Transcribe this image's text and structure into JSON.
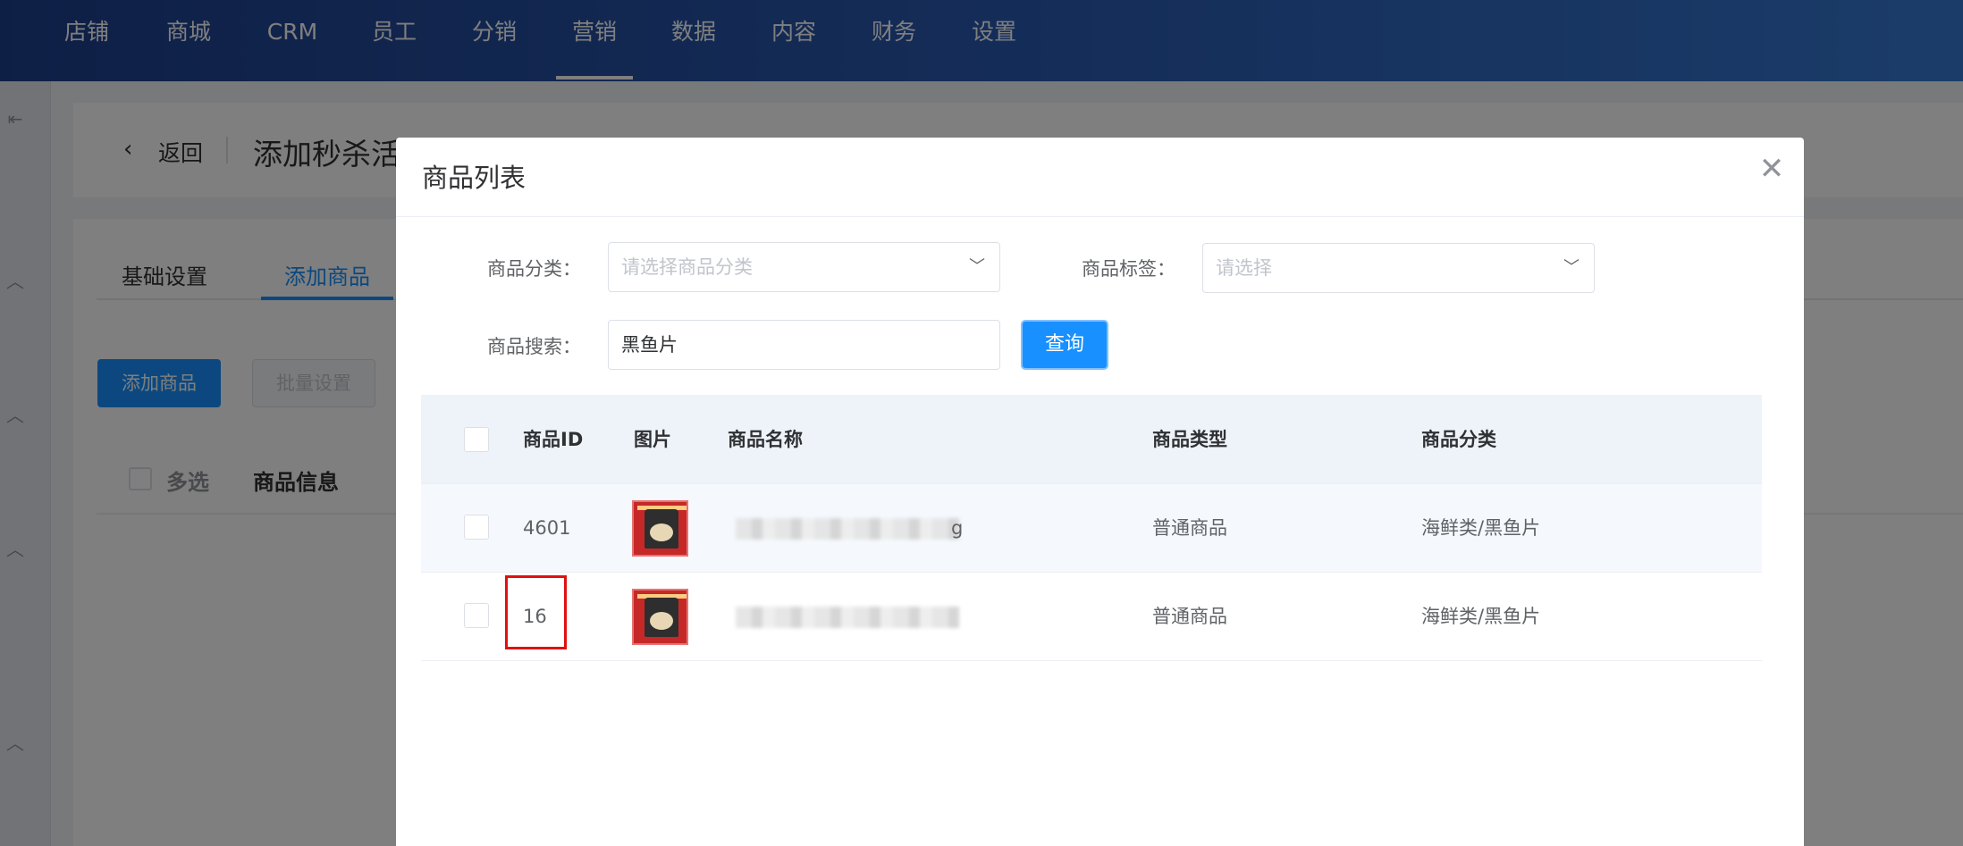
{
  "topnav": {
    "items": [
      "店铺",
      "商城",
      "CRM",
      "员工",
      "分销",
      "营销",
      "数据",
      "内容",
      "财务",
      "设置"
    ],
    "active": "营销",
    "gradient": [
      "#1d3f8c",
      "#3778d2"
    ]
  },
  "page": {
    "back_label": "返回",
    "title": "添加秒杀活",
    "tabs": [
      "基础设置",
      "添加商品"
    ],
    "active_tab": "添加商品",
    "add_product_button": "添加商品",
    "batch_set_button": "批量设置",
    "multi_select_label": "多选",
    "product_info_header": "商品信息"
  },
  "dialog": {
    "title": "商品列表",
    "filters": {
      "category_label": "商品分类：",
      "category_placeholder": "请选择商品分类",
      "tag_label": "商品标签：",
      "tag_placeholder": "请选择",
      "search_label": "商品搜索：",
      "search_value": "黑鱼片",
      "query_button": "查询"
    },
    "table": {
      "columns": [
        "商品ID",
        "图片",
        "商品名称",
        "商品类型",
        "商品分类"
      ],
      "rows": [
        {
          "id": "4601",
          "name": "g",
          "type": "普通商品",
          "category": "海鲜类/黑鱼片"
        },
        {
          "id": "16",
          "name": "",
          "type": "普通商品",
          "category": "海鲜类/黑鱼片"
        }
      ]
    }
  },
  "colors": {
    "accent": "#1890ff",
    "highlight_box": "#e01010"
  }
}
